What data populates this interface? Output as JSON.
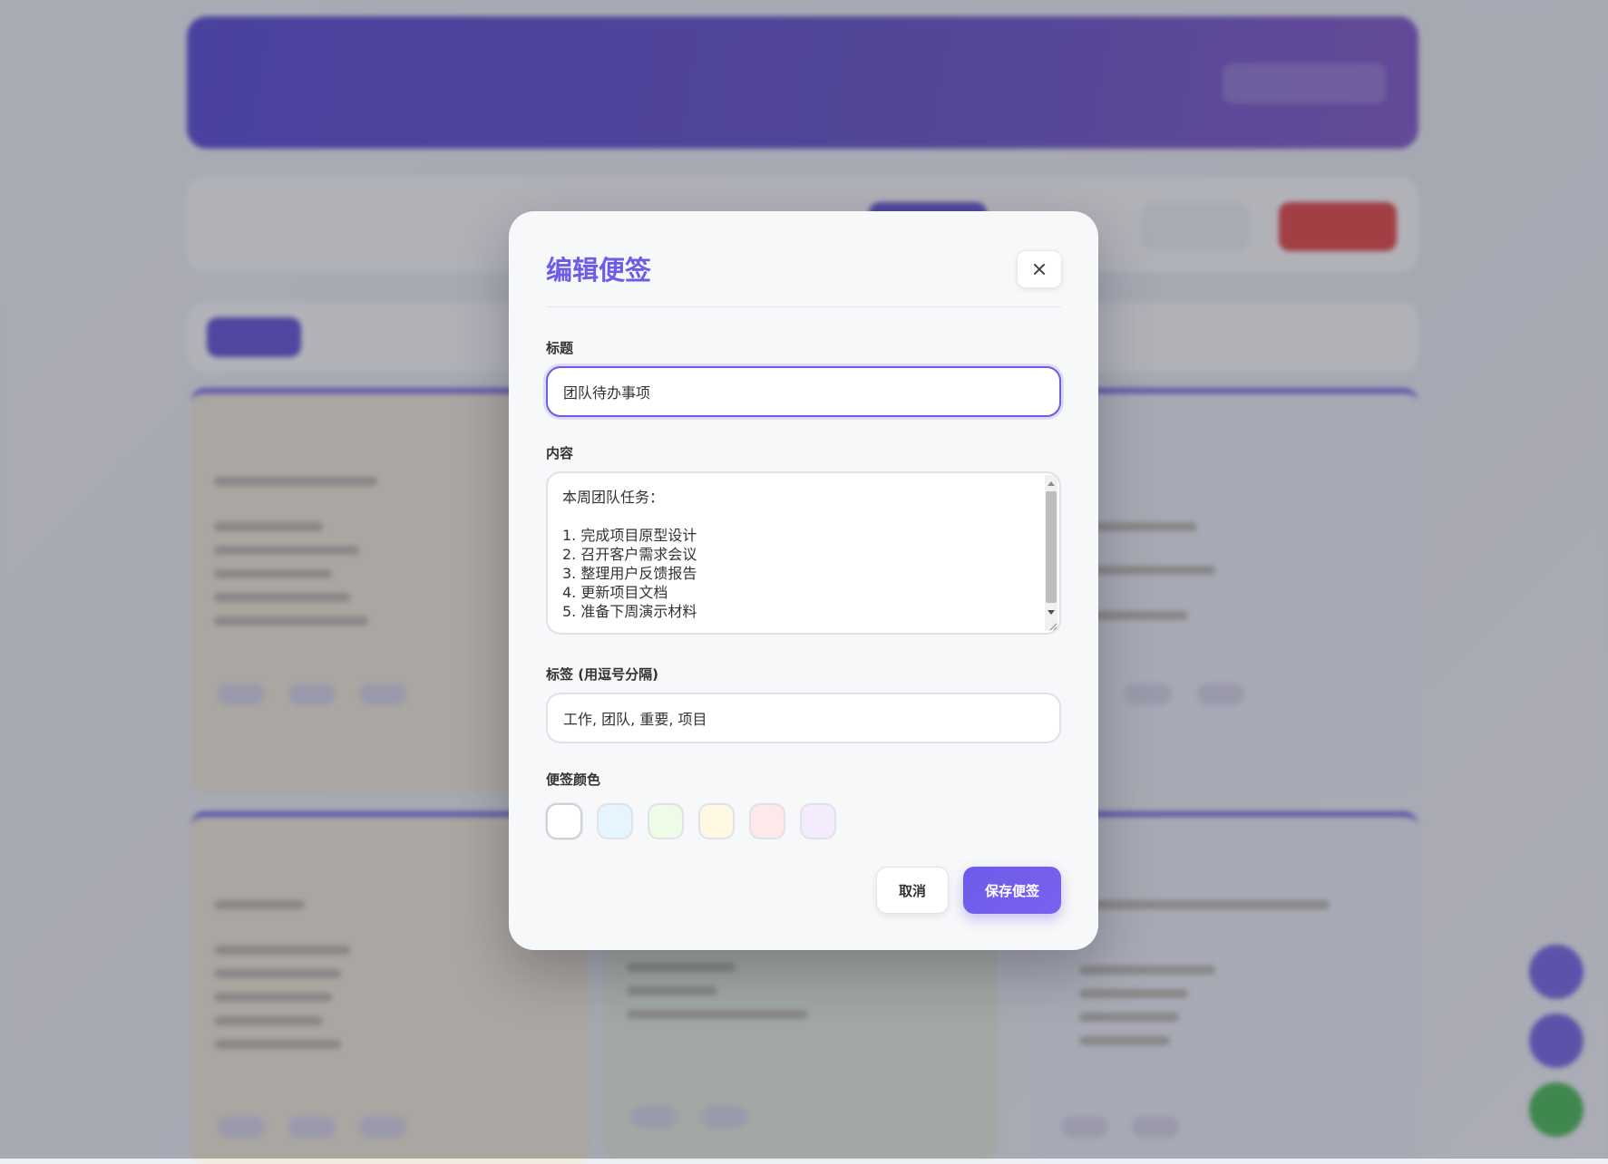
{
  "modal": {
    "title": "编辑便签",
    "fields": {
      "title_label": "标题",
      "title_value": "团队待办事项",
      "content_label": "内容",
      "content_value": "本周团队任务：\n\n1. 完成项目原型设计\n2. 召开客户需求会议\n3. 整理用户反馈报告\n4. 更新项目文档\n5. 准备下周演示材料",
      "tags_label": "标签 (用逗号分隔)",
      "tags_value": "工作, 团队, 重要, 项目",
      "color_label": "便签颜色"
    },
    "colors": [
      "#ffffff",
      "#e6f4fd",
      "#eefbe6",
      "#fff8e3",
      "#fde9e9",
      "#f4ecfc"
    ],
    "selected_color": "#ffffff",
    "buttons": {
      "cancel": "取消",
      "save": "保存便签"
    },
    "accent_color": "#6c5ce7"
  }
}
